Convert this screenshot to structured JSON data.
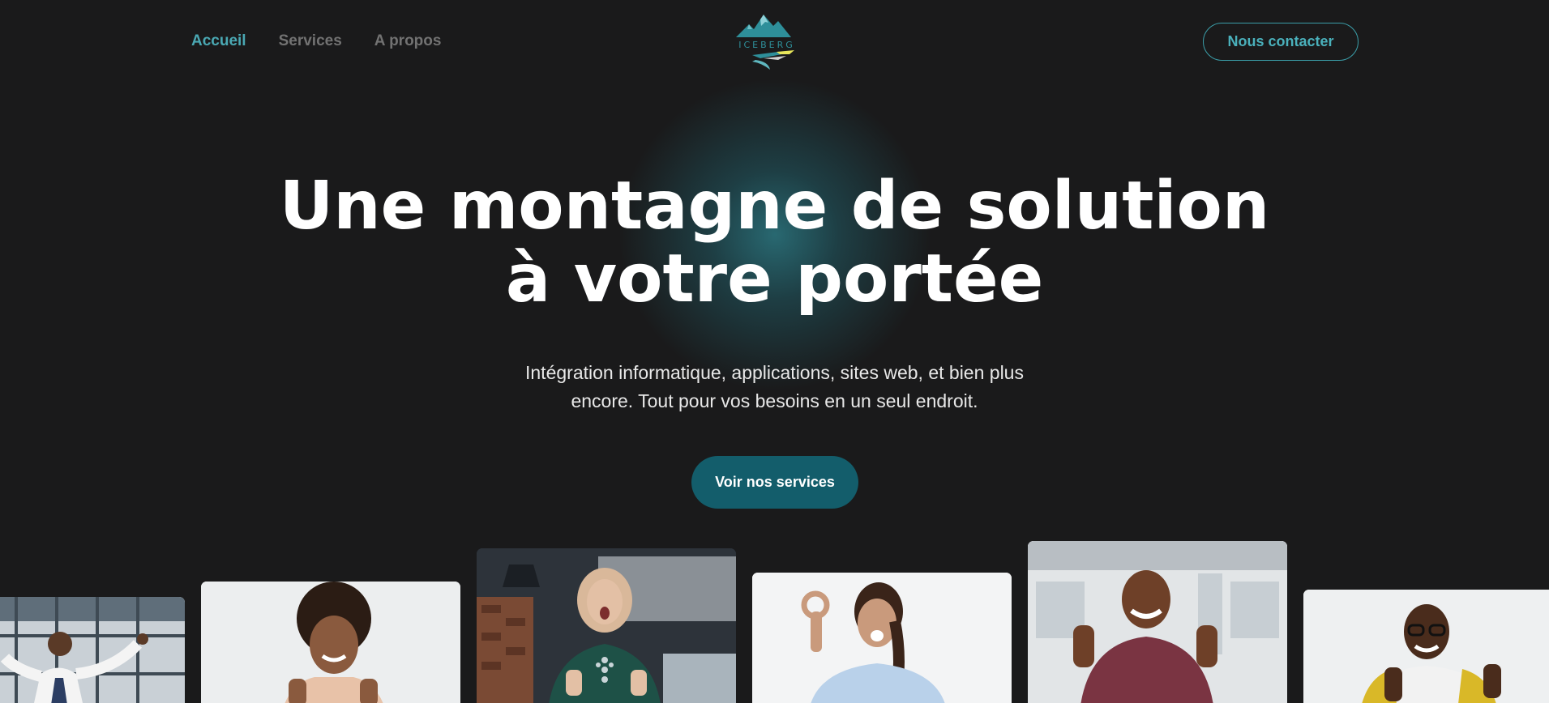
{
  "nav": {
    "links": [
      {
        "label": "Accueil",
        "active": true
      },
      {
        "label": "Services",
        "active": false
      },
      {
        "label": "A propos",
        "active": false
      }
    ],
    "logo_text": "ICEBERG",
    "contact_label": "Nous contacter"
  },
  "hero": {
    "title_line1": "Une montagne de solution",
    "title_line2": "à votre portée",
    "subtitle": "Intégration informatique, applications, sites web, et bien plus encore. Tout pour vos besoins en un seul endroit.",
    "cta_label": "Voir nos services"
  },
  "gallery": {
    "photos": [
      {
        "name": "man-celebrating-photo"
      },
      {
        "name": "woman-thumbs-up-photo"
      },
      {
        "name": "woman-hijab-thumbs-up-photo"
      },
      {
        "name": "woman-ok-gesture-photo"
      },
      {
        "name": "man-thumbs-up-photo"
      },
      {
        "name": "man-glasses-thumbs-up-photo"
      }
    ]
  },
  "colors": {
    "background": "#1a1a1b",
    "accent": "#4aa8b3",
    "cta": "#135d6b"
  }
}
